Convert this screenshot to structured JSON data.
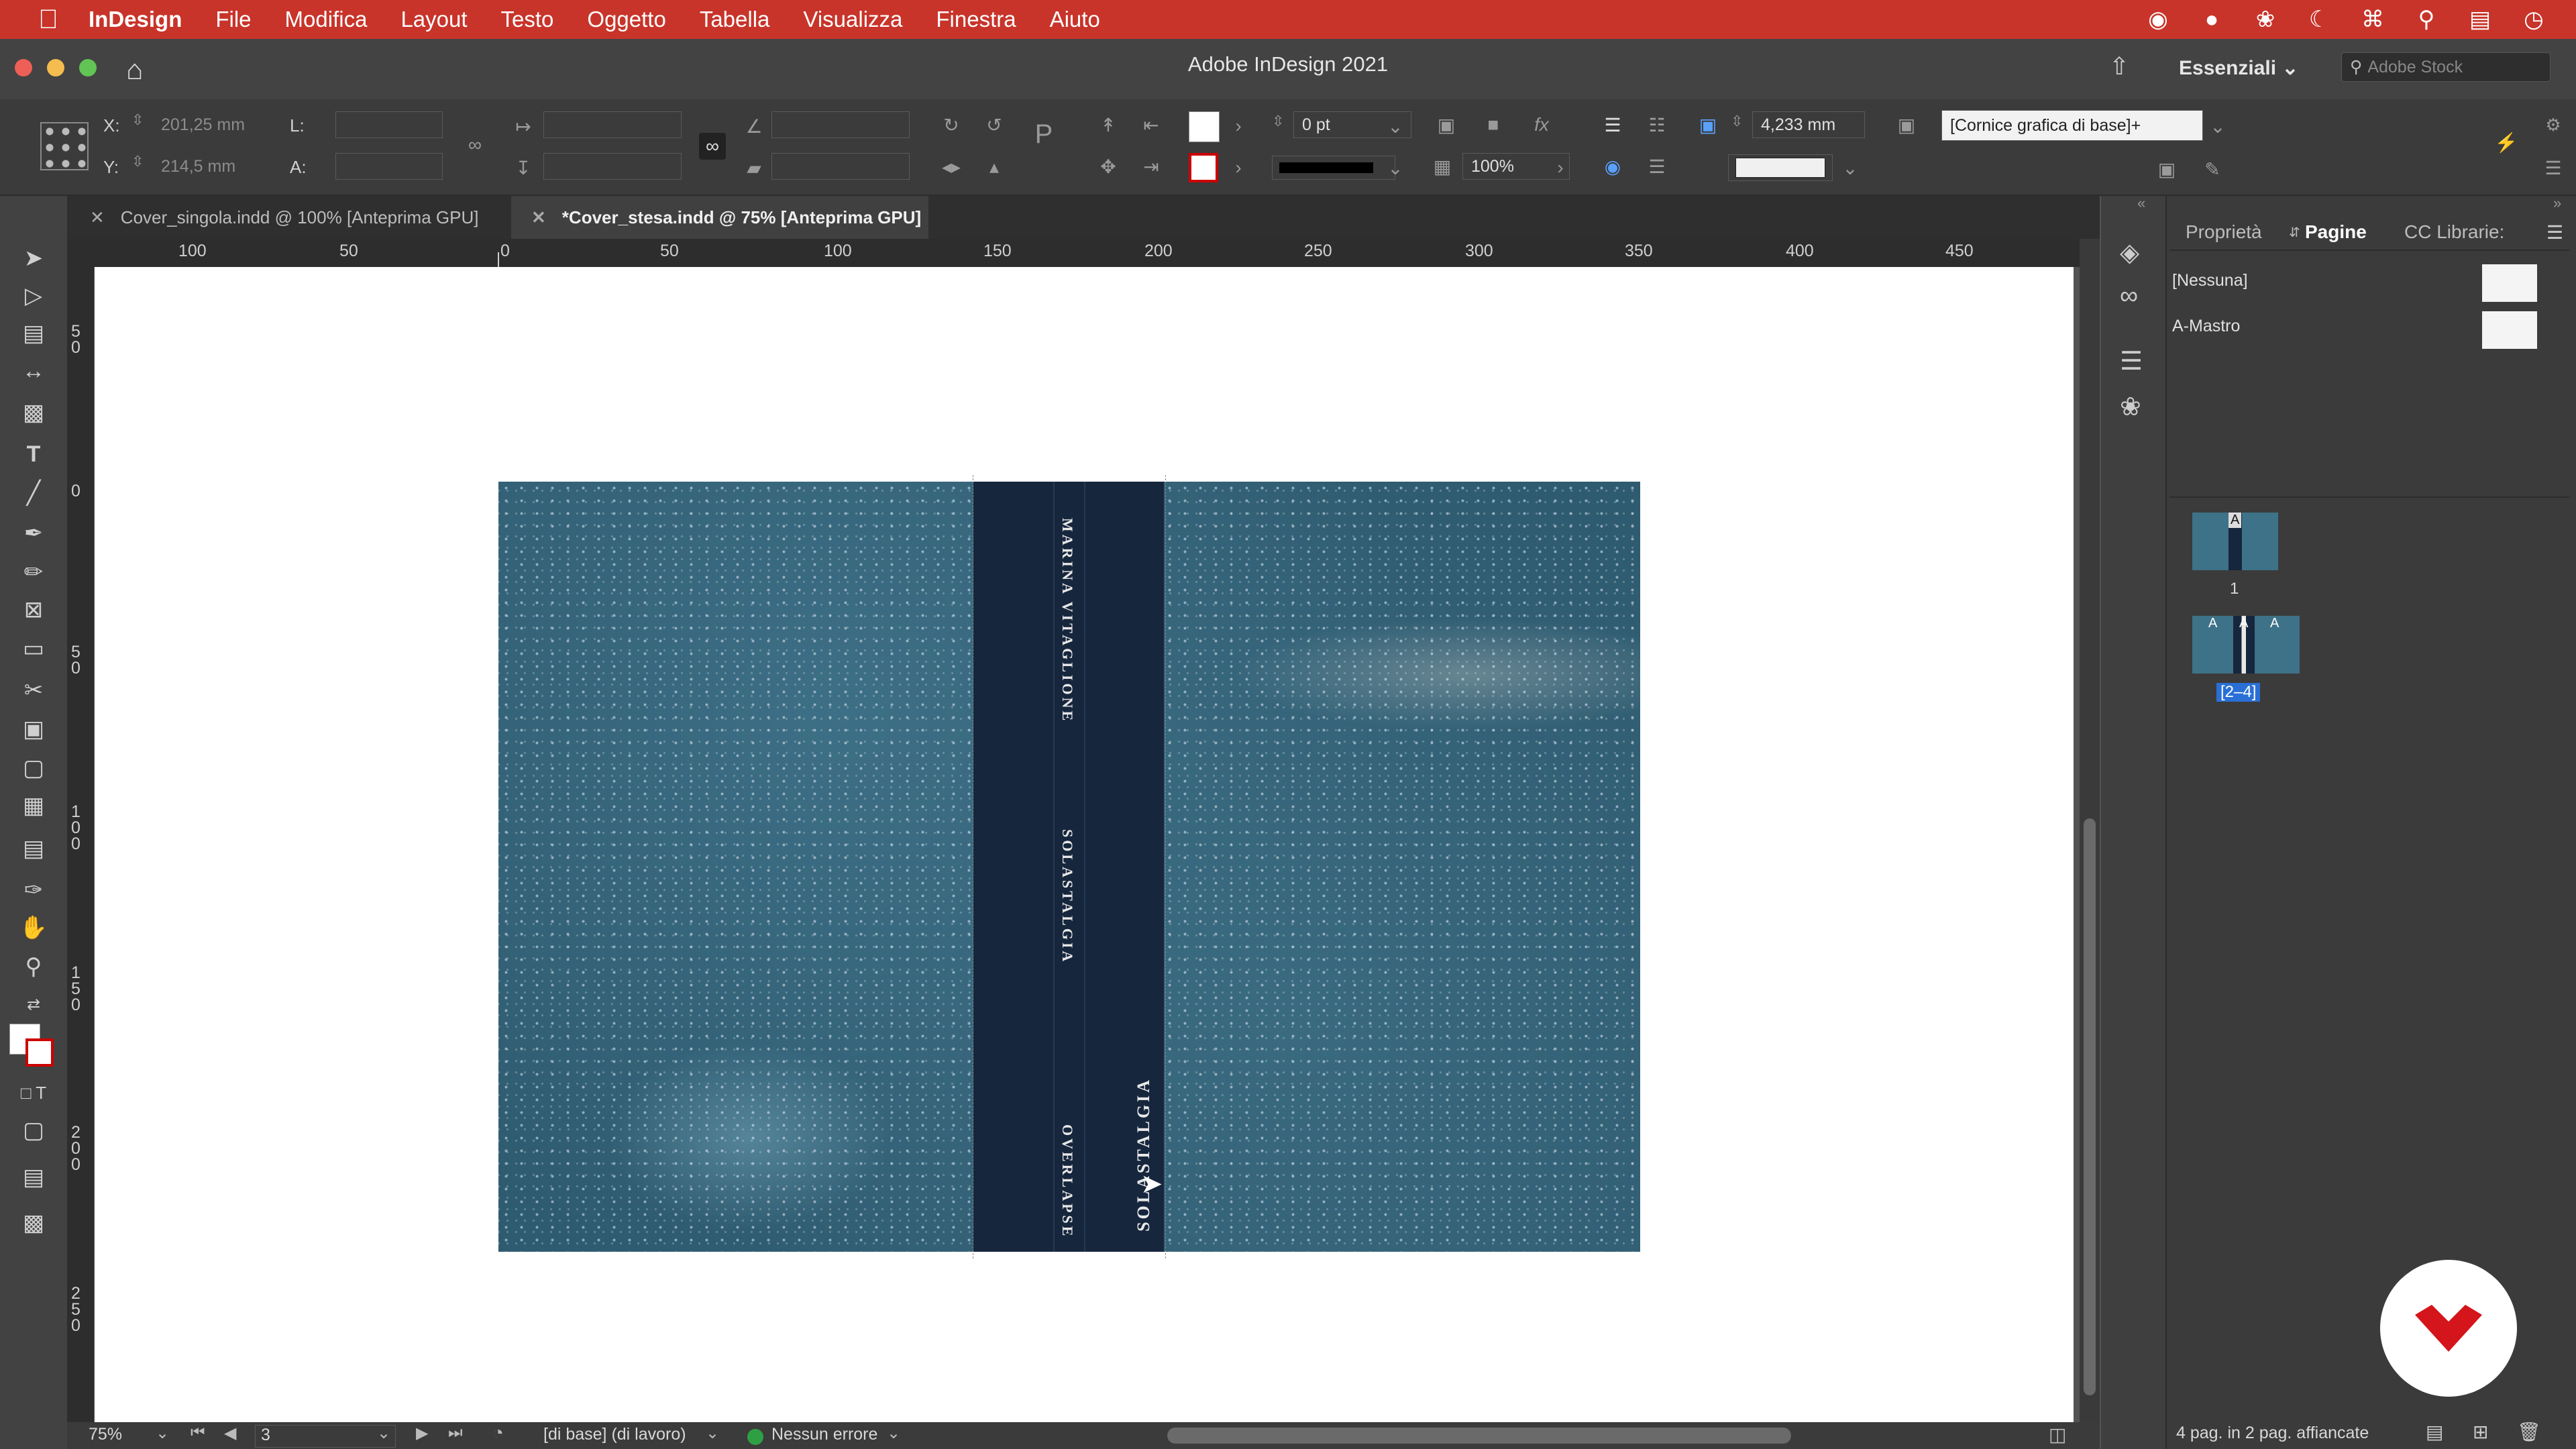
{
  "menubar": {
    "app_name": "InDesign",
    "items": [
      "File",
      "Modifica",
      "Layout",
      "Testo",
      "Oggetto",
      "Tabella",
      "Visualizza",
      "Finestra",
      "Aiuto"
    ]
  },
  "titlebar": {
    "title": "Adobe InDesign 2021",
    "workspace": "Essenziali",
    "search_placeholder": "Adobe Stock"
  },
  "controlbar": {
    "x_label": "X:",
    "x_value": "201,25 mm",
    "y_label": "Y:",
    "y_value": "214,5 mm",
    "w_label": "L:",
    "h_label": "A:",
    "stroke_weight": "0 pt",
    "scale": "100%",
    "fitting_value": "4,233 mm",
    "object_style": "[Cornice grafica di base]+"
  },
  "tabs": [
    {
      "label": "Cover_singola.indd @ 100% [Anteprima GPU]"
    },
    {
      "label": "*Cover_stesa.indd @ 75% [Anteprima GPU]"
    }
  ],
  "ruler": {
    "h_ticks": [
      "100",
      "50",
      "0",
      "50",
      "100",
      "150",
      "200",
      "250",
      "300",
      "350",
      "400",
      "450"
    ],
    "v_ticks": [
      "5\n0",
      "0",
      "5\n0",
      "1\n0\n0",
      "1\n5\n0",
      "2\n0\n0",
      "2\n5\n0"
    ]
  },
  "spine": {
    "author": "MARINA VITAGLIONE",
    "title": "SOLASTALGIA",
    "publisher": "OVERLAPSE",
    "placed_text": "SOLASTALGIA"
  },
  "statusbar": {
    "zoom": "75%",
    "page": "3",
    "style": "[di base] (di lavoro)",
    "preflight": "Nessun errore"
  },
  "panel": {
    "tabs": [
      "Proprietà",
      "Pagine",
      "CC Librarie:"
    ],
    "none_master": "[Nessuna]",
    "a_master": "A-Mastro",
    "page1_label": "1",
    "spread_label": "[2–4]",
    "master_letter": "A",
    "footer": "4 pag. in 2 pag. affiancate"
  },
  "colors": {
    "menubar": "#c8342a",
    "spine": "#16263d",
    "cover": "#2f5b70",
    "preflight_ok": "#2ea043"
  }
}
